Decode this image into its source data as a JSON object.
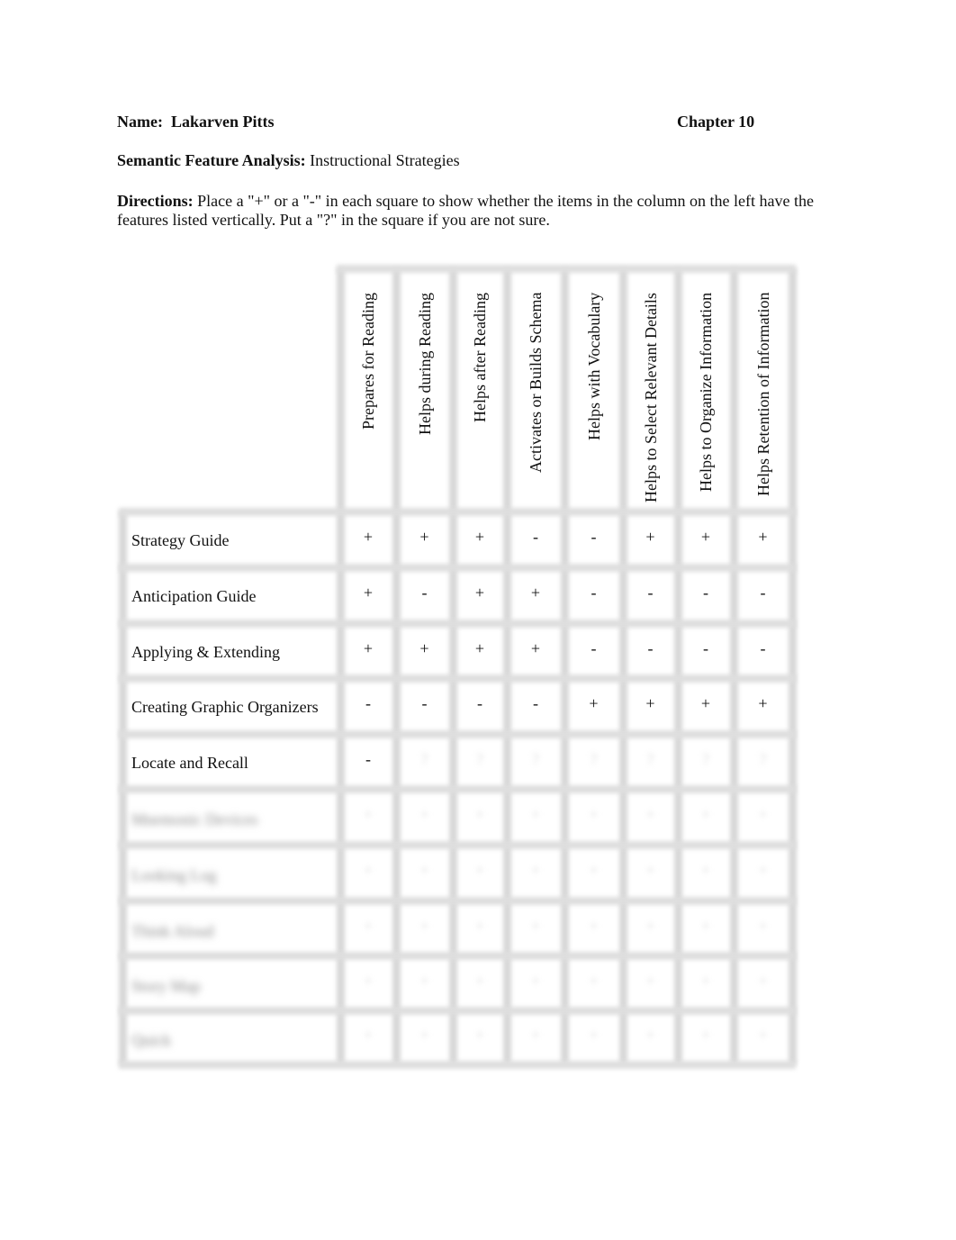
{
  "header": {
    "name_label": "Name:",
    "name_value": "Lakarven Pitts",
    "chapter": "Chapter 10",
    "sfa_label": "Semantic Feature Analysis:",
    "sfa_value": "Instructional Strategies",
    "directions_label": "Directions:",
    "directions_text": "Place a \"+\" or a \"-\" in each square to show whether the items in the column on the left have the features listed vertically. Put a \"?\" in the square if you are not sure."
  },
  "table": {
    "columns": [
      "Prepares for Reading",
      "Helps during Reading",
      "Helps after Reading",
      "Activates or Builds Schema",
      "Helps with Vocabulary",
      "Helps to Select Relevant Details",
      "Helps to Organize Information",
      "Helps Retention of Information"
    ],
    "rows": [
      {
        "label": "Strategy Guide",
        "values": [
          "+",
          "+",
          "+",
          "-",
          "-",
          "+",
          "+",
          "+"
        ]
      },
      {
        "label": "Anticipation Guide",
        "values": [
          "+",
          "-",
          "+",
          "+",
          "-",
          "-",
          "-",
          "-"
        ]
      },
      {
        "label": "Applying & Extending",
        "values": [
          "+",
          "+",
          "+",
          "+",
          "-",
          "-",
          "-",
          "-"
        ]
      },
      {
        "label": "Creating Graphic Organizers",
        "values": [
          "-",
          "-",
          "-",
          "-",
          "+",
          "+",
          "+",
          "+"
        ]
      },
      {
        "label": "Locate and Recall",
        "values": [
          "-",
          "",
          "",
          "",
          "",
          "",
          "",
          ""
        ]
      }
    ],
    "blurred_rows": [
      {
        "label": "Mnemonic Devices"
      },
      {
        "label": "Looking Log"
      },
      {
        "label": "Think Aloud"
      },
      {
        "label": "Story Map"
      },
      {
        "label": "Quick"
      }
    ]
  }
}
